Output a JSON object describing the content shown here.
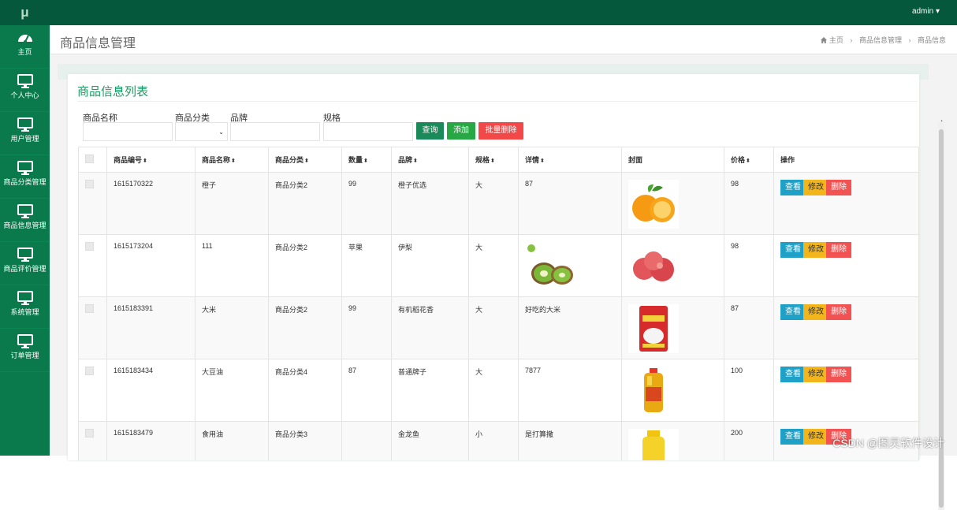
{
  "app": {
    "logo": "μ",
    "user": "admin",
    "user_caret": "▾"
  },
  "sidebar": [
    {
      "label": "主页",
      "icon": "dashboard-icon"
    },
    {
      "label": "个人中心",
      "icon": "monitor-icon"
    },
    {
      "label": "用户管理",
      "icon": "monitor-icon"
    },
    {
      "label": "商品分类管理",
      "icon": "monitor-icon"
    },
    {
      "label": "商品信息管理",
      "icon": "monitor-icon"
    },
    {
      "label": "商品评价管理",
      "icon": "monitor-icon"
    },
    {
      "label": "系统管理",
      "icon": "monitor-icon"
    },
    {
      "label": "订单管理",
      "icon": "monitor-icon"
    }
  ],
  "header": {
    "title": "商品信息管理",
    "breadcrumb": [
      "主页",
      "商品信息管理",
      "商品信息"
    ],
    "home_icon": "home-icon"
  },
  "panel": {
    "title": "商品信息列表",
    "filters": {
      "name_label": "商品名称",
      "category_label": "商品分类",
      "brand_label": "品牌",
      "spec_label": "规格",
      "name_value": "",
      "brand_value": "",
      "spec_value": "",
      "category_selected": ""
    },
    "buttons": {
      "query": "查询",
      "add": "添加",
      "batch_delete": "批量删除"
    }
  },
  "table": {
    "headers": [
      "",
      "商品编号",
      "商品名称",
      "商品分类",
      "数量",
      "品牌",
      "规格",
      "详情",
      "封面",
      "价格",
      "操作"
    ],
    "sort_icon": "⬍",
    "rows": [
      {
        "id": "1615170322",
        "name": "橙子",
        "category": "商品分类2",
        "qty": "99",
        "brand": "橙子优选",
        "spec": "大",
        "detail": "87",
        "cover": "orange",
        "price": "98"
      },
      {
        "id": "1615173204",
        "name": "111",
        "category": "商品分类2",
        "qty": "苹果",
        "brand": "伊梨",
        "spec": "大",
        "detail": "",
        "detail_image": "kiwi",
        "cover": "apple",
        "price": "98"
      },
      {
        "id": "1615183391",
        "name": "大米",
        "category": "商品分类2",
        "qty": "99",
        "brand": "有机稻花香",
        "spec": "大",
        "detail": "好吃的大米",
        "cover": "rice",
        "price": "87"
      },
      {
        "id": "1615183434",
        "name": "大豆油",
        "category": "商品分类4",
        "qty": "87",
        "brand": "普通牌子",
        "spec": "大",
        "detail": "7877",
        "cover": "oil",
        "price": "100"
      },
      {
        "id": "1615183479",
        "name": "食用油",
        "category": "商品分类3",
        "qty": "",
        "brand": "金龙鱼",
        "spec": "小",
        "detail": "是打算撒",
        "cover": "oil2",
        "price": "200"
      }
    ],
    "actions": {
      "view": "查看",
      "edit": "修改",
      "delete": "删除"
    }
  },
  "watermark": "CSDN @图灵软件设计"
}
